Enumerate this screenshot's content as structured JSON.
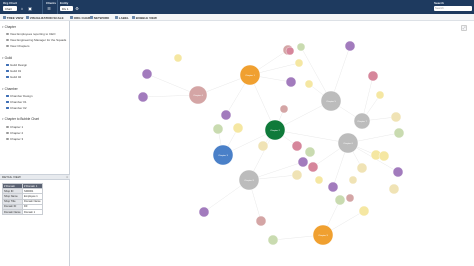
{
  "topbar": {
    "title": "Org Chart",
    "view_select": "Chart",
    "clients_label": "Clients",
    "client_select": "Jan 2023",
    "entity_label": "Entity",
    "entity_select": "Div 1",
    "search_label": "Search",
    "search_placeholder": "Search"
  },
  "subbar": {
    "items": [
      "TREE VIEW",
      "VISUALIZATION SCALE",
      "ORG CHART",
      "NETWORK",
      "LABEL",
      "BUBBLE VIEW"
    ]
  },
  "filters": [
    {
      "title": "Chapter",
      "kind": "radio",
      "options": [
        {
          "label": "View Employees reporting to CEO",
          "on": false
        },
        {
          "label": "View Engineering Manager for the Squads",
          "on": false
        },
        {
          "label": "View Chapters",
          "on": false
        }
      ]
    },
    {
      "title": "Guild",
      "kind": "check",
      "options": [
        {
          "label": "Guild Design",
          "on": true
        },
        {
          "label": "Guild 01",
          "on": true
        },
        {
          "label": "Guild 02",
          "on": true
        }
      ]
    },
    {
      "title": "Chamber",
      "kind": "check",
      "options": [
        {
          "label": "Chamber Design",
          "on": true
        },
        {
          "label": "Chamber 01",
          "on": true
        },
        {
          "label": "Chamber 02",
          "on": true
        }
      ]
    },
    {
      "title": "Chapter to Bubble Chart",
      "kind": "radio",
      "options": [
        {
          "label": "Chapter 1",
          "on": false
        },
        {
          "label": "Chapter 2",
          "on": false
        },
        {
          "label": "Chapter 3",
          "on": false
        }
      ]
    }
  ],
  "detail": {
    "title": "DETAIL VIEW",
    "close": "×",
    "columns": [
      "# Domain",
      "# Domain 1"
    ],
    "rows": [
      {
        "k": "Shop ID",
        "v": "SD0001"
      },
      {
        "k": "Shop Name",
        "v": "Employee 1"
      },
      {
        "k": "Shop Title",
        "v": "Domain Name"
      },
      {
        "k": "Domain ID",
        "v": "D0"
      },
      {
        "k": "Domain Name",
        "v": "Domain 1"
      }
    ]
  },
  "graph": {
    "colors": {
      "orange": "#f0a030",
      "green": "#0f7a3a",
      "blue": "#4a80c8",
      "gray": "#bcbcbc",
      "rose": "#d4a5a5",
      "purple": "#a27bbd",
      "yellow": "#f5e7a2",
      "sage": "#c9dbb0",
      "pink": "#d6869b",
      "cream": "#f0e3b5",
      "edge": "#d8d8d8"
    },
    "big_node_labels": [
      "Chapter 1",
      "Chapter 2",
      "Chapter 3",
      "Chapter 4",
      "Chapter 5",
      "Chapter 6",
      "Chapter 7",
      "Chapter 8",
      "Chapter 9"
    ]
  }
}
